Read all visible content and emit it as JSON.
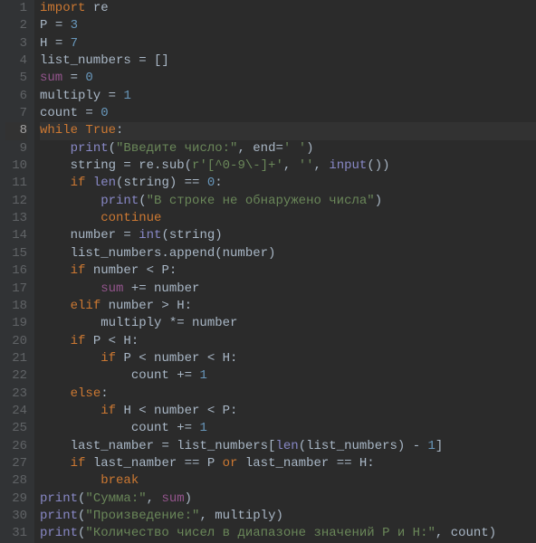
{
  "lines": [
    {
      "n": "1",
      "tokens": [
        [
          "kw",
          "import "
        ],
        [
          "def",
          "re"
        ]
      ]
    },
    {
      "n": "2",
      "tokens": [
        [
          "def",
          "P "
        ],
        [
          "op",
          "= "
        ],
        [
          "num",
          "3"
        ]
      ]
    },
    {
      "n": "3",
      "tokens": [
        [
          "def",
          "H "
        ],
        [
          "op",
          "= "
        ],
        [
          "num",
          "7"
        ]
      ]
    },
    {
      "n": "4",
      "tokens": [
        [
          "def",
          "list_numbers "
        ],
        [
          "op",
          "= []"
        ]
      ]
    },
    {
      "n": "5",
      "tokens": [
        [
          "sum",
          "sum "
        ],
        [
          "op",
          "= "
        ],
        [
          "num",
          "0"
        ]
      ]
    },
    {
      "n": "6",
      "tokens": [
        [
          "def",
          "multiply "
        ],
        [
          "op",
          "= "
        ],
        [
          "num",
          "1"
        ]
      ]
    },
    {
      "n": "7",
      "tokens": [
        [
          "def",
          "count "
        ],
        [
          "op",
          "= "
        ],
        [
          "num",
          "0"
        ]
      ]
    },
    {
      "n": "8",
      "current": true,
      "tokens": [
        [
          "kw",
          "while "
        ],
        [
          "kw",
          "True"
        ],
        [
          "op",
          ":"
        ]
      ]
    },
    {
      "n": "9",
      "tokens": [
        [
          "op",
          "    "
        ],
        [
          "builtin",
          "print"
        ],
        [
          "op",
          "("
        ],
        [
          "str",
          "\"Введите число:\""
        ],
        [
          "op",
          ", "
        ],
        [
          "def",
          "end"
        ],
        [
          "op",
          "="
        ],
        [
          "str",
          "' '"
        ],
        [
          "op",
          ")"
        ]
      ]
    },
    {
      "n": "10",
      "tokens": [
        [
          "op",
          "    "
        ],
        [
          "def",
          "string "
        ],
        [
          "op",
          "= re.sub("
        ],
        [
          "str",
          "r'[^0-9\\-]+'"
        ],
        [
          "op",
          ", "
        ],
        [
          "str",
          "''"
        ],
        [
          "op",
          ", "
        ],
        [
          "builtin",
          "input"
        ],
        [
          "op",
          "())"
        ]
      ]
    },
    {
      "n": "11",
      "tokens": [
        [
          "op",
          "    "
        ],
        [
          "kw",
          "if "
        ],
        [
          "builtin",
          "len"
        ],
        [
          "op",
          "(string) == "
        ],
        [
          "num",
          "0"
        ],
        [
          "op",
          ":"
        ]
      ]
    },
    {
      "n": "12",
      "tokens": [
        [
          "op",
          "        "
        ],
        [
          "builtin",
          "print"
        ],
        [
          "op",
          "("
        ],
        [
          "str",
          "\"В строке не обнаружено числа\""
        ],
        [
          "op",
          ")"
        ]
      ]
    },
    {
      "n": "13",
      "tokens": [
        [
          "op",
          "        "
        ],
        [
          "kw",
          "continue"
        ]
      ]
    },
    {
      "n": "14",
      "tokens": [
        [
          "op",
          "    "
        ],
        [
          "def",
          "number "
        ],
        [
          "op",
          "= "
        ],
        [
          "builtin",
          "int"
        ],
        [
          "op",
          "(string)"
        ]
      ]
    },
    {
      "n": "15",
      "tokens": [
        [
          "op",
          "    list_numbers.append(number)"
        ]
      ]
    },
    {
      "n": "16",
      "tokens": [
        [
          "op",
          "    "
        ],
        [
          "kw",
          "if "
        ],
        [
          "op",
          "number < P:"
        ]
      ]
    },
    {
      "n": "17",
      "tokens": [
        [
          "op",
          "        "
        ],
        [
          "sum",
          "sum "
        ],
        [
          "op",
          "+= number"
        ]
      ]
    },
    {
      "n": "18",
      "tokens": [
        [
          "op",
          "    "
        ],
        [
          "kw",
          "elif "
        ],
        [
          "op",
          "number > H:"
        ]
      ]
    },
    {
      "n": "19",
      "tokens": [
        [
          "op",
          "        multiply *= number"
        ]
      ]
    },
    {
      "n": "20",
      "tokens": [
        [
          "op",
          "    "
        ],
        [
          "kw",
          "if "
        ],
        [
          "op",
          "P < H:"
        ]
      ]
    },
    {
      "n": "21",
      "tokens": [
        [
          "op",
          "        "
        ],
        [
          "kw",
          "if "
        ],
        [
          "op",
          "P < number < H:"
        ]
      ]
    },
    {
      "n": "22",
      "tokens": [
        [
          "op",
          "            count += "
        ],
        [
          "num",
          "1"
        ]
      ]
    },
    {
      "n": "23",
      "tokens": [
        [
          "op",
          "    "
        ],
        [
          "kw",
          "else"
        ],
        [
          "op",
          ":"
        ]
      ]
    },
    {
      "n": "24",
      "tokens": [
        [
          "op",
          "        "
        ],
        [
          "kw",
          "if "
        ],
        [
          "op",
          "H < number < P:"
        ]
      ]
    },
    {
      "n": "25",
      "tokens": [
        [
          "op",
          "            count += "
        ],
        [
          "num",
          "1"
        ]
      ]
    },
    {
      "n": "26",
      "tokens": [
        [
          "op",
          "    "
        ],
        [
          "def",
          "last_namber "
        ],
        [
          "op",
          "= list_numbers["
        ],
        [
          "builtin",
          "len"
        ],
        [
          "op",
          "(list_numbers) - "
        ],
        [
          "num",
          "1"
        ],
        [
          "op",
          "]"
        ]
      ]
    },
    {
      "n": "27",
      "tokens": [
        [
          "op",
          "    "
        ],
        [
          "kw",
          "if "
        ],
        [
          "op",
          "last_namber == P "
        ],
        [
          "kw",
          "or "
        ],
        [
          "op",
          "last_namber == H:"
        ]
      ]
    },
    {
      "n": "28",
      "tokens": [
        [
          "op",
          "        "
        ],
        [
          "kw",
          "break"
        ]
      ]
    },
    {
      "n": "29",
      "tokens": [
        [
          "builtin",
          "print"
        ],
        [
          "op",
          "("
        ],
        [
          "str",
          "\"Сумма:\""
        ],
        [
          "op",
          ", "
        ],
        [
          "sum",
          "sum"
        ],
        [
          "op",
          ")"
        ]
      ]
    },
    {
      "n": "30",
      "tokens": [
        [
          "builtin",
          "print"
        ],
        [
          "op",
          "("
        ],
        [
          "str",
          "\"Произведение:\""
        ],
        [
          "op",
          ", multiply)"
        ]
      ]
    },
    {
      "n": "31",
      "tokens": [
        [
          "builtin",
          "print"
        ],
        [
          "op",
          "("
        ],
        [
          "str",
          "\"Количество чисел в диапазоне значений P и H:\""
        ],
        [
          "op",
          ", count)"
        ]
      ]
    }
  ],
  "gutterLabel": "line-numbers"
}
